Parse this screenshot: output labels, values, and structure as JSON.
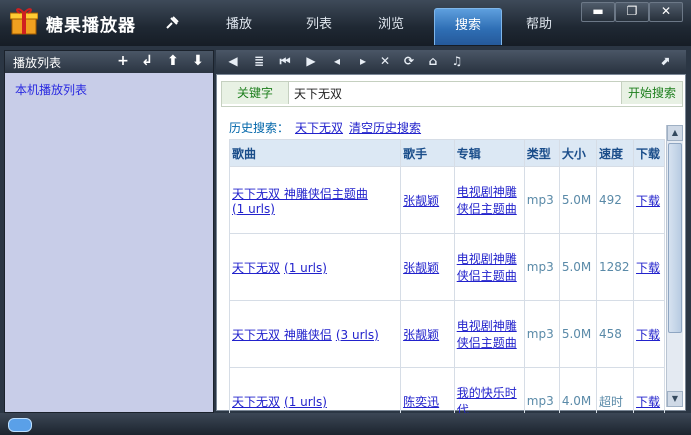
{
  "app": {
    "title": "糖果播放器"
  },
  "tabs": [
    {
      "label": "播放"
    },
    {
      "label": "列表"
    },
    {
      "label": "浏览"
    },
    {
      "label": "搜索",
      "active": true
    },
    {
      "label": "帮助"
    }
  ],
  "window_controls": {
    "minimize": "▬",
    "restore": "❐",
    "close": "✕"
  },
  "left_panel": {
    "title": "播放列表",
    "icons": [
      "add-icon",
      "loop-icon",
      "up-arrow-icon",
      "down-arrow-icon"
    ],
    "icon_glyphs": [
      "+",
      "↲",
      "⬆",
      "⬇"
    ],
    "items": [
      "本机播放列表"
    ]
  },
  "toolbar": {
    "icons": [
      "back-icon",
      "list-icon",
      "prev-icon",
      "play-icon",
      "rewind-icon",
      "forward-icon",
      "delete-icon",
      "refresh-icon",
      "home-icon",
      "music-note-icon",
      "collapse-icon"
    ],
    "glyphs": [
      "◀",
      "≣",
      "⏮",
      "▶",
      "◂",
      "▸",
      "✕",
      "⟳",
      "⌂",
      "♫",
      "⬈"
    ]
  },
  "search": {
    "keyword_label": "关键字",
    "value": "天下无双",
    "button_label": "开始搜索"
  },
  "history": {
    "label": "历史搜索：",
    "items": [
      "天下无双"
    ],
    "clear_label": "清空历史搜索"
  },
  "table": {
    "headers": [
      "歌曲",
      "歌手",
      "专辑",
      "类型",
      "大小",
      "速度",
      "下载"
    ],
    "rows": [
      {
        "song": "天下无双 神雕侠侣主题曲",
        "urls": "(1 urls)",
        "artist": "张靓颖",
        "album": "电视剧神雕侠侣主题曲",
        "type": "mp3",
        "size": "5.0M",
        "speed": "492",
        "download": "下载"
      },
      {
        "song": "天下无双",
        "urls": "(1 urls)",
        "artist": "张靓颖",
        "album": "电视剧神雕侠侣主题曲",
        "type": "mp3",
        "size": "5.0M",
        "speed": "1282",
        "download": "下载"
      },
      {
        "song": "天下无双 神雕侠侣",
        "urls": "(3 urls)",
        "artist": "张靓颖",
        "album": "电视剧神雕侠侣主题曲",
        "type": "mp3",
        "size": "5.0M",
        "speed": "458",
        "download": "下载"
      },
      {
        "song": "天下无双",
        "urls": "(1 urls)",
        "artist": "陈奕迅",
        "album": "我的快乐时代",
        "type": "mp3",
        "size": "4.0M",
        "speed": "超时",
        "download": "下载"
      }
    ]
  },
  "colors": {
    "accent": "#2f6fb5",
    "link": "#2222cc",
    "keyword_green": "#1d7f1d",
    "panel_bg": "#c8cde8"
  }
}
